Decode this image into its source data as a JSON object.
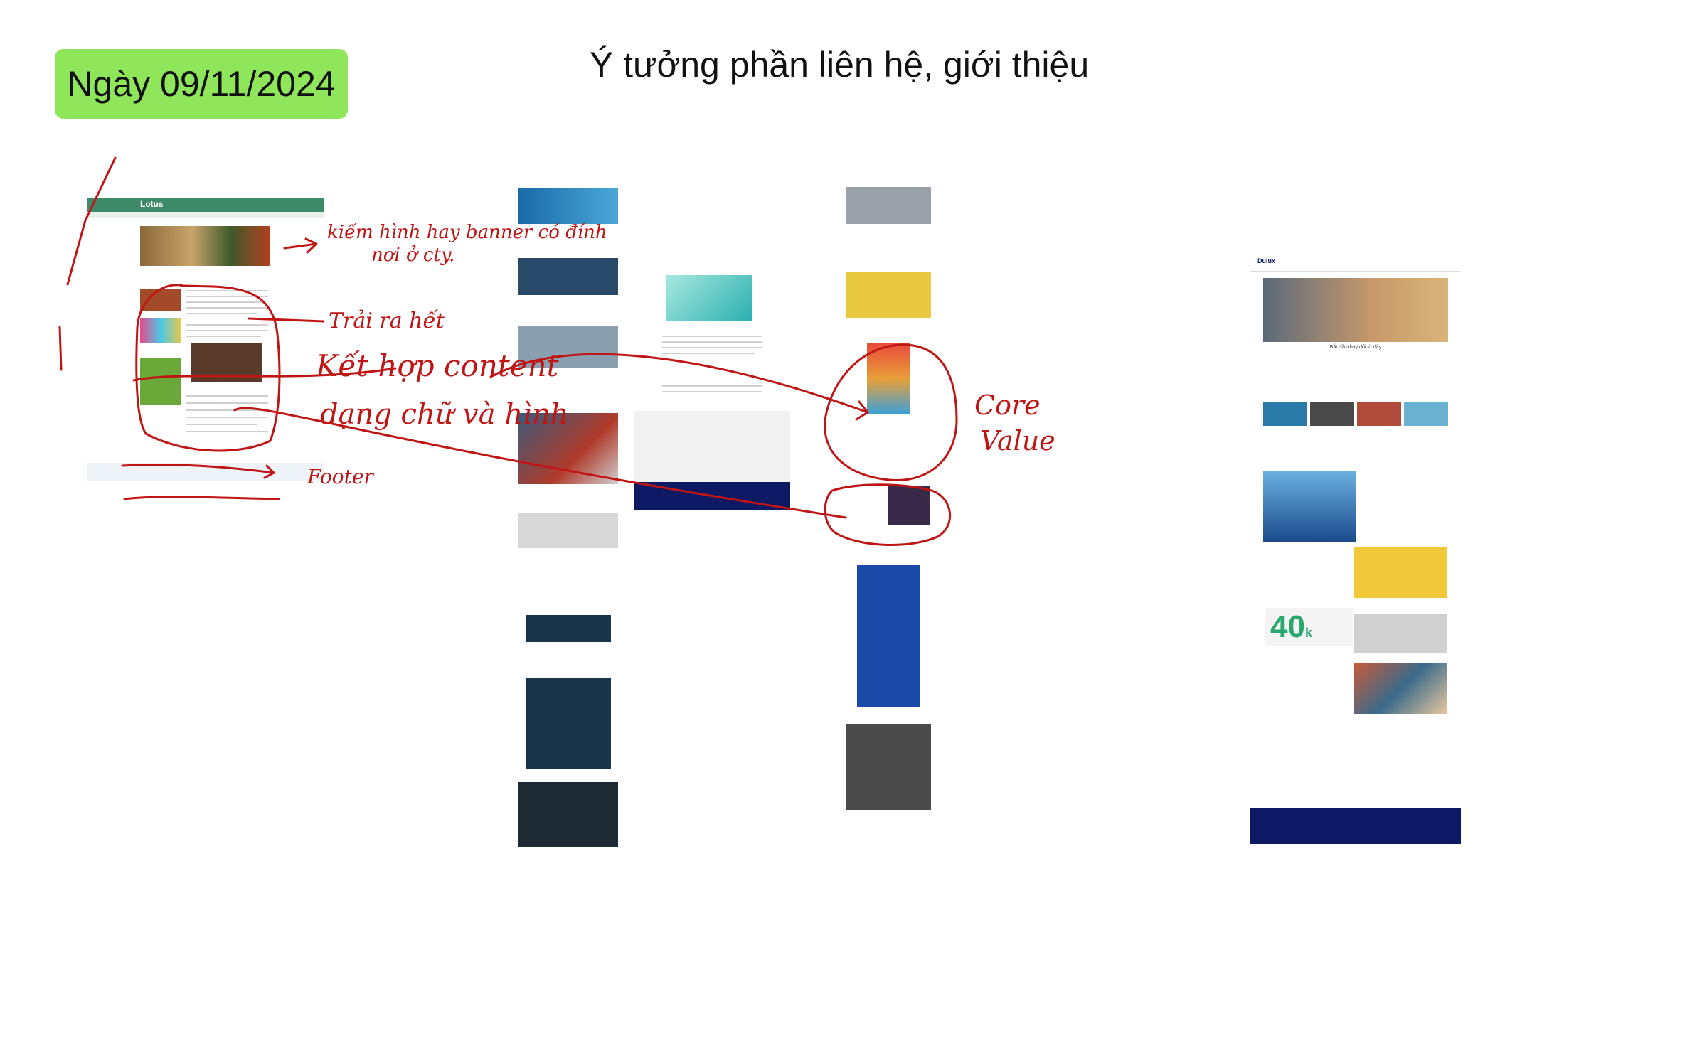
{
  "header": {
    "date_badge": "Ngày 09/11/2024",
    "title": "Ý tưởng phần liên hệ, giới thiệu"
  },
  "mockups": {
    "lotus": {
      "logo": "Lotus"
    },
    "dulux": {
      "logo": "Dulux",
      "hero_caption": "Bắt đầu thay đổi từ đây",
      "big_number": "40",
      "big_unit": "k"
    }
  },
  "annotations": {
    "banner_note": "kiếm hình hay banner có đính",
    "banner_note_2": "nơi ở cty.",
    "layout_note": "Trải ra hết",
    "content_note": "Kết hợp content",
    "content_note_2": "dạng chữ và hình",
    "footer_note": "Footer",
    "core_value": "Core",
    "core_value_2": "Value"
  },
  "colors": {
    "badge": "#8fe65a",
    "ink": "#c01515",
    "lotus_green": "#3d8a6a",
    "dulux_navy": "#0d1a63",
    "navy_dark": "#17344a"
  }
}
